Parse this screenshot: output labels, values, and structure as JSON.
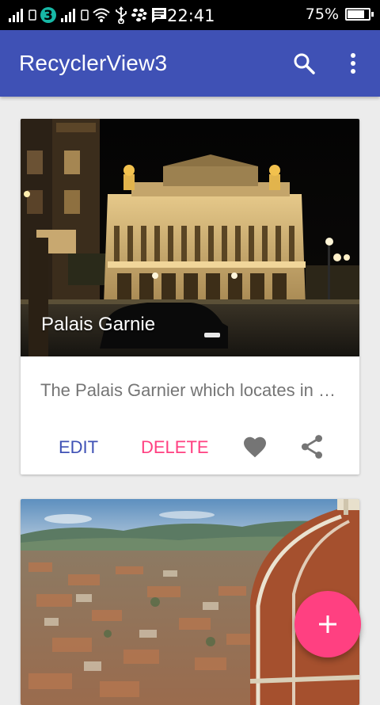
{
  "status_bar": {
    "time": "22:41",
    "battery_percent": "75%",
    "battery_level": 0.75,
    "carrier_badge": "3",
    "icons": [
      "signal-icon",
      "carrier-3-icon",
      "signal-icon",
      "wifi-icon",
      "usb-icon",
      "blackberry-icon",
      "message-icon"
    ]
  },
  "app_bar": {
    "title": "RecyclerView3",
    "color": "#3f51b5",
    "actions": [
      "search-icon",
      "more-vert-icon"
    ]
  },
  "cards": [
    {
      "title": "Palais Garnie",
      "description": "The Palais Garnier which locates in Paris, France...",
      "edit_label": "EDIT",
      "delete_label": "DELETE",
      "icons": [
        "heart-icon",
        "share-icon"
      ]
    },
    {
      "title": "",
      "image": "florence-cathedral-photo"
    }
  ],
  "fab": {
    "icon": "plus-icon",
    "color": "#ff4081"
  },
  "colors": {
    "primary": "#3f51b5",
    "accent": "#ff4081",
    "secondary_text": "#757575"
  }
}
